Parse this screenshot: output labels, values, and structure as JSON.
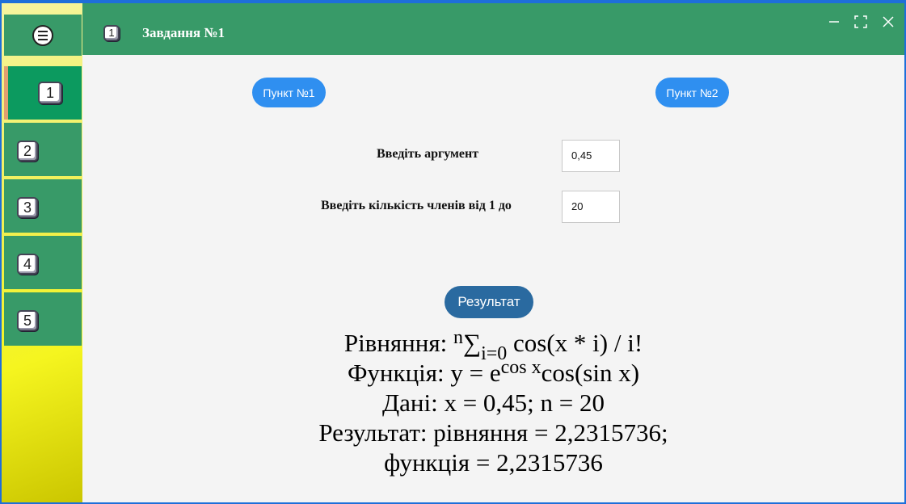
{
  "window": {
    "title": "Завдання №1",
    "title_icon_label": "1",
    "controls": [
      "minimize-icon",
      "maximize-icon",
      "close-icon"
    ]
  },
  "sidebar": {
    "menu_icon": "hamburger-icon",
    "items": [
      {
        "label": "1",
        "active": true
      },
      {
        "label": "2",
        "active": false
      },
      {
        "label": "3",
        "active": false
      },
      {
        "label": "4",
        "active": false
      },
      {
        "label": "5",
        "active": false
      }
    ]
  },
  "tabs": {
    "point1": "Пункт №1",
    "point2": "Пункт №2"
  },
  "form": {
    "argument_label": "Введіть аргумент",
    "argument_value": "0,45",
    "count_label": "Введіть кількість членів від 1 до",
    "count_value": "20"
  },
  "result_button": "Результат",
  "output": {
    "equation_prefix": "Рівняння: ",
    "equation_sup": "n",
    "equation_sigma": "∑",
    "equation_sub": "i=0",
    "equation_rest": " cos(x * i) / i!",
    "function_prefix": "Функція: y = e",
    "function_sup": "cos x",
    "function_rest": "cos(sin x)",
    "data_line": "Дані: x = 0,45; n = 20",
    "result_line": "Результат: рівняння = 2,2315736;",
    "function_result_line": "функція = 2,2315736"
  },
  "colors": {
    "accent_green": "#389a68",
    "active_green": "#0c9a5f",
    "pill_blue": "#2f8ff0",
    "result_blue": "#2a6aa0",
    "window_border": "#1e6fd9"
  }
}
